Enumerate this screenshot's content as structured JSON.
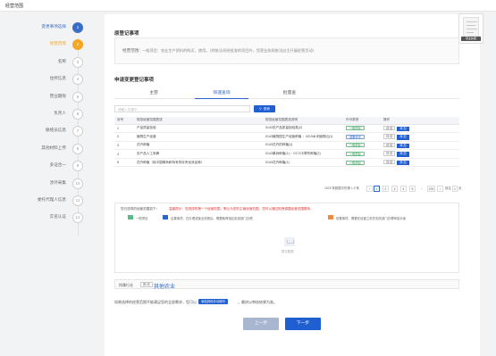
{
  "app": {
    "title": "经营范围"
  },
  "steps": [
    {
      "label": "变更事项选择",
      "num": "1",
      "state": "done"
    },
    {
      "label": "经营范围",
      "num": "2",
      "state": "active"
    },
    {
      "label": "名称",
      "num": "3",
      "state": "todo"
    },
    {
      "label": "住所信息",
      "num": "4",
      "state": "todo"
    },
    {
      "label": "营业期限",
      "num": "5",
      "state": "todo"
    },
    {
      "label": "负责人",
      "num": "6",
      "state": "todo"
    },
    {
      "label": "联络员信息",
      "num": "7",
      "state": "todo"
    },
    {
      "label": "其他材料上传",
      "num": "8",
      "state": "todo"
    },
    {
      "label": "多证合一",
      "num": "9",
      "state": "todo"
    },
    {
      "label": "涉外采集",
      "num": "10",
      "state": "todo"
    },
    {
      "label": "委托代理人信息",
      "num": "11",
      "state": "todo"
    },
    {
      "label": "实名认证",
      "num": "12",
      "state": "todo"
    }
  ],
  "thumbnail": {
    "caption": "营业执照"
  },
  "original": {
    "title": "原登记事项",
    "key": "经营范围：",
    "value": "一般项目：农业生产资料的购买、使用。（除依法须经批准的项目外，凭营业执照依法自主开展经营活动）"
  },
  "apply": {
    "title": "申请变更登记事项",
    "tabs": [
      "主营",
      "快速查询",
      "批量查"
    ],
    "active_tab": 1,
    "search_placeholder": "请输入关键字",
    "search_button": "查询"
  },
  "table": {
    "headers": [
      "序号",
      "规范经营范围表述",
      "规范经营范围表述说明",
      "许可类别",
      "操作"
    ],
    "rows": [
      {
        "no": "1",
        "name": "产品质量检验",
        "code": "0143农产品质量检验类(2)",
        "type": "一般项目",
        "detail": "详 情",
        "add": "添 加"
      },
      {
        "no": "2",
        "name": "植物生产经营",
        "code": "0143植物园生产经营种植 ：0219木本植物出(1)",
        "type": "重要许可",
        "detail": "详 情",
        "add": "添 加"
      },
      {
        "no": "3",
        "name": "花卉种植",
        "code": "0143花卉的种植(1)",
        "type": "一般项目",
        "detail": "详 情",
        "add": "添 加"
      },
      {
        "no": "4",
        "name": "农产品人工采摘",
        "code": "0143果树种植(1) ：0171中草药种植(2)",
        "type": "一般项目",
        "detail": "详 情",
        "add": "添 加"
      },
      {
        "no": "5",
        "name": "花卉种植（除中国稀有和特有的珍贵优良品种）",
        "code": "0143花卉种植(1)",
        "type": "一般项目",
        "detail": "详 情",
        "add": "添 加"
      }
    ]
  },
  "pagination": {
    "summary": "1878 条数据中的第 1-5 条",
    "pages": [
      "1",
      "2",
      "3",
      "4",
      "5",
      "...",
      "376"
    ],
    "goto_prefix": "前往",
    "goto_value": "1",
    "goto_suffix": "页"
  },
  "selection": {
    "heading": "您已选择的经营范围如下：",
    "warning": "温馨提示：您选择的第一个经营范围，默认为您的主营经营范围，您可以通过拖拽调整经营范围顺序。",
    "legend": [
      {
        "label": "一般项目",
        "color": "#5bb98b"
      },
      {
        "label": "后置事项，在办理或营业执照后，需要取得相应批准部门办理",
        "color": "#2b66c9"
      },
      {
        "label": "前置事项，需要在经营之前先相关部门办理审批手续",
        "color": "#f08a3c"
      }
    ],
    "empty_text": "暂无数据"
  },
  "industry": {
    "label": "所属行业",
    "clear_label": "修 改",
    "value": "其他农业"
  },
  "bottom_note": {
    "prefix": "如果选择的经营范围不能满足您的全部需求，您可以",
    "button": "添加其他手动填写",
    "suffix": "，最终以审核结果为准。"
  },
  "nav": {
    "prev": "上一步",
    "next": "下一步"
  }
}
